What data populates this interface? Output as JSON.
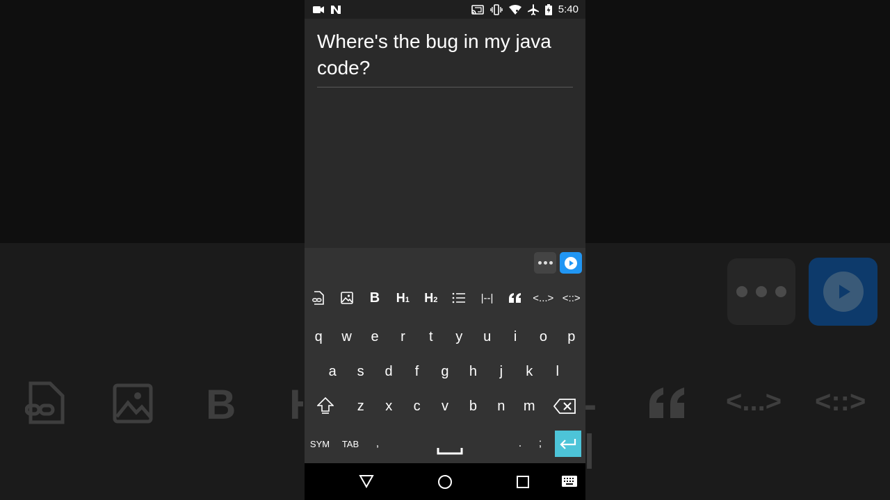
{
  "status_bar": {
    "time": "5:40",
    "icons": [
      "video-camera-icon",
      "n-app-icon",
      "cast-icon",
      "vibrate-icon",
      "wifi-icon",
      "airplane-icon",
      "battery-charging-icon"
    ]
  },
  "editor": {
    "title": "Where's the bug in my java code?"
  },
  "keyboard": {
    "toolbar": [
      "more-options",
      "play"
    ],
    "format_row": [
      "attachment-icon",
      "image-icon",
      "B",
      "H1",
      "H2",
      "list-icon",
      "|--|",
      "quote-icon",
      "<...>",
      "<::>"
    ],
    "row1": [
      "q",
      "w",
      "e",
      "r",
      "t",
      "y",
      "u",
      "i",
      "o",
      "p"
    ],
    "row2": [
      "a",
      "s",
      "d",
      "f",
      "g",
      "h",
      "j",
      "k",
      "l"
    ],
    "row3": [
      "z",
      "x",
      "c",
      "v",
      "b",
      "n",
      "m"
    ],
    "sym": "SYM",
    "tab": "TAB",
    "comma": ",",
    "period": ".",
    "semicolon": ";"
  },
  "format_labels": {
    "bold": "B",
    "h1": "H",
    "h1_sub": "1",
    "h2": "H",
    "h2_sub": "2",
    "hr": "|--|",
    "code_inline": "<...>",
    "code_block": "<::>"
  },
  "colors": {
    "accent_blue": "#2196f3",
    "enter_key": "#4dc4d8"
  }
}
